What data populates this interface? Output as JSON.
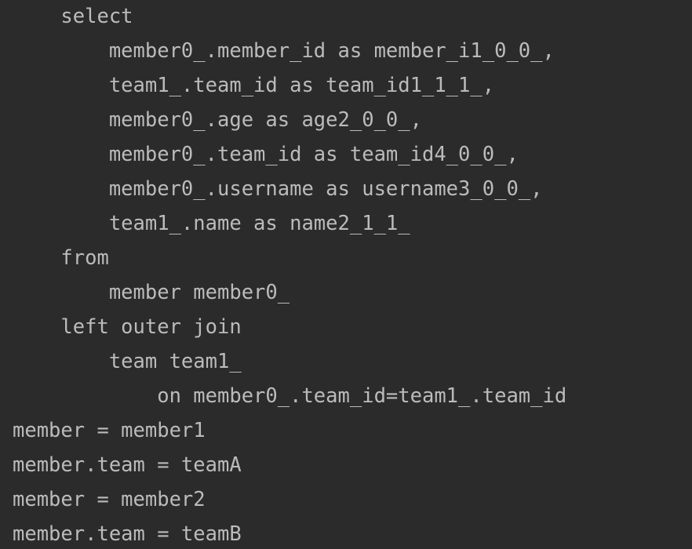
{
  "console": {
    "lines": [
      "    select",
      "        member0_.member_id as member_i1_0_0_,",
      "        team1_.team_id as team_id1_1_1_,",
      "        member0_.age as age2_0_0_,",
      "        member0_.team_id as team_id4_0_0_,",
      "        member0_.username as username3_0_0_,",
      "        team1_.name as name2_1_1_",
      "    from",
      "        member member0_",
      "    left outer join",
      "        team team1_",
      "            on member0_.team_id=team1_.team_id",
      "member = member1",
      "member.team = teamA",
      "member = member2",
      "member.team = teamB"
    ]
  },
  "colors": {
    "background": "#2b2b2b",
    "text": "#bbbbbb"
  }
}
